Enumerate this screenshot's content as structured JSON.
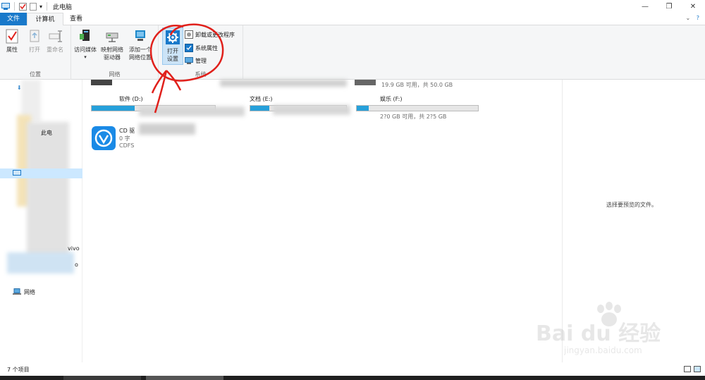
{
  "window": {
    "title": "此电脑",
    "controls": {
      "minimize": "—",
      "maximize": "❐",
      "close": "✕"
    }
  },
  "ribbon_tabs": [
    {
      "label": "文件"
    },
    {
      "label": "计算机"
    },
    {
      "label": "查看"
    }
  ],
  "ribbon": {
    "groups": {
      "location": {
        "label": "位置",
        "buttons": [
          "属性",
          "打开",
          "重命名"
        ]
      },
      "network": {
        "label": "网络",
        "buttons": [
          "访问媒体",
          "映射网络\n驱动器",
          "添加一个\n网络位置"
        ]
      },
      "system": {
        "label": "系统",
        "open_settings": "打开\n设置",
        "small_buttons": [
          "卸载或更改程序",
          "系统属性",
          "管理"
        ]
      }
    }
  },
  "drives": [
    {
      "name": "",
      "info": "19.9 GB 可用，共 50.0 GB",
      "fill": 0.6
    },
    {
      "name": "软件 (D:)",
      "info": "",
      "fill": 0.35
    },
    {
      "name": "文档 (E:)",
      "info": "",
      "fill": 0.2
    },
    {
      "name": "娱乐 (F:)",
      "info": "2?0 GB 可用，共 2?5 GB",
      "fill": 0.1
    }
  ],
  "cd_drive": {
    "name": "CD 驱",
    "info": "0 字",
    "fs": "CDFS"
  },
  "nav_items": [
    {
      "label": "此电"
    },
    {
      "label": "vivo"
    },
    {
      "label": "o"
    },
    {
      "label": "网络"
    }
  ],
  "preview": {
    "message": "选择要预览的文件。"
  },
  "status": {
    "item_count": "7 个项目"
  },
  "watermark": {
    "brand": "Bai du 经验",
    "url": "jingyan.baidu.com"
  },
  "colors": {
    "accent": "#1979ca",
    "annotation": "#e0201b",
    "drive_bar": "#26a0da"
  }
}
